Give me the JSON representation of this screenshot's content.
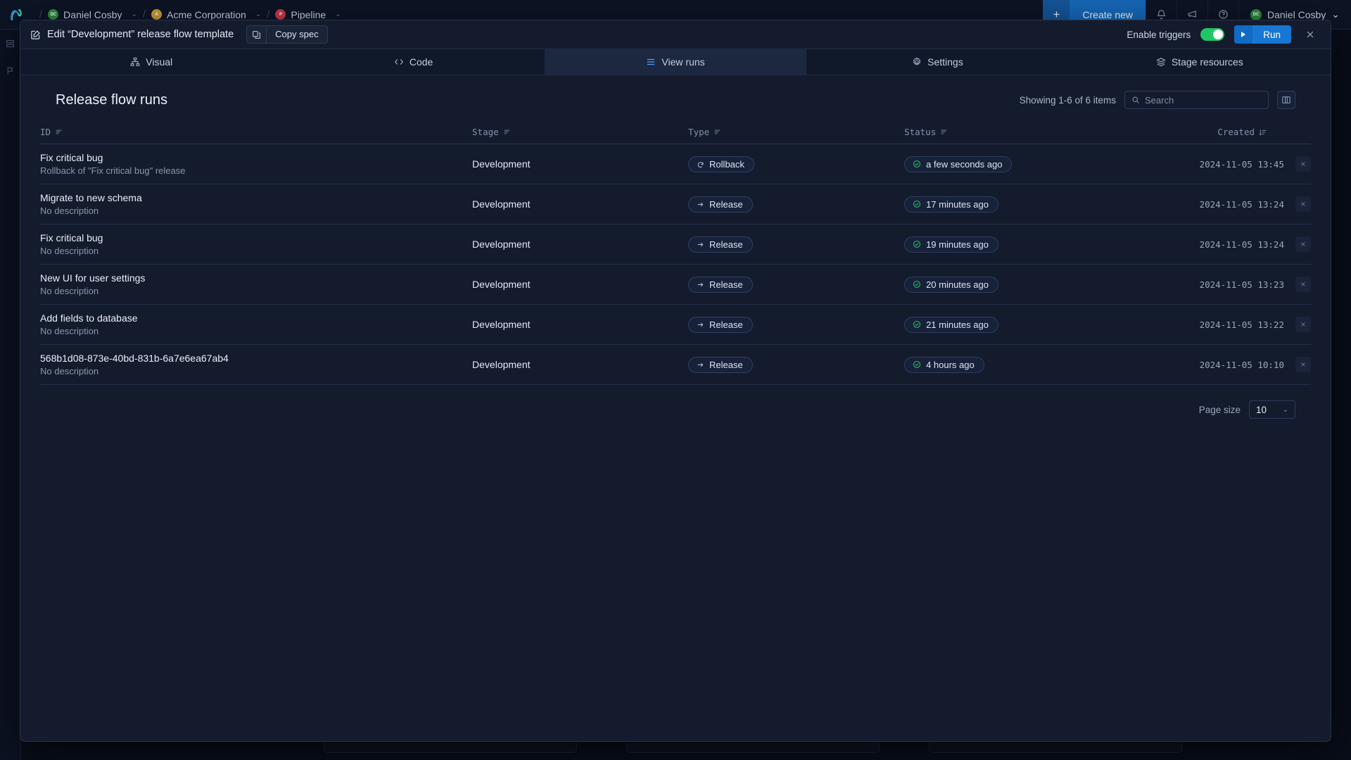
{
  "background": {
    "breadcrumbs": [
      {
        "label": "Daniel Cosby",
        "avatar_initials": "DC",
        "avatar_color": "#2d8a3e",
        "chevron": "⌄"
      },
      {
        "label": "Acme Corporation",
        "avatar_initials": "A",
        "avatar_color": "#c99a3a",
        "chevron": "⌄"
      },
      {
        "label": "Pipeline",
        "avatar_initials": "P",
        "avatar_color": "#c2384a",
        "chevron": "⌄"
      }
    ],
    "create_new_label": "Create new",
    "plus_glyph": "+",
    "top_icons": [
      "bell-icon",
      "megaphone-icon",
      "help-icon"
    ],
    "user": {
      "name": "Daniel Cosby",
      "initials": "DC",
      "chevron": "⌄"
    }
  },
  "modal": {
    "header": {
      "edit_icon": "pencil-square-icon",
      "title": "Edit “Development” release flow template",
      "copy_spec": {
        "icon": "copy-icon",
        "label": "Copy spec"
      },
      "enable_triggers_label": "Enable triggers",
      "enable_triggers_on": true,
      "toggle_color": "#20c566",
      "run": {
        "icon": "play-icon",
        "label": "Run",
        "color": "#1877d2"
      },
      "close": "close-icon"
    },
    "tabs": [
      {
        "label": "Visual",
        "icon": "sitemap-icon",
        "active": false
      },
      {
        "label": "Code",
        "icon": "code-icon",
        "active": false
      },
      {
        "label": "View runs",
        "icon": "list-icon",
        "active": true
      },
      {
        "label": "Settings",
        "icon": "gear-icon",
        "active": false
      },
      {
        "label": "Stage resources",
        "icon": "layers-icon",
        "active": false
      }
    ],
    "body": {
      "page_title": "Release flow runs",
      "showing_text": "Showing 1-6 of 6 items",
      "search": {
        "placeholder": "Search",
        "value": "",
        "icon": "search-icon"
      },
      "column_toggle_icon": "columns-icon",
      "table": {
        "columns": [
          {
            "label": "ID",
            "sort_icon": "sort-icon"
          },
          {
            "label": "Stage",
            "sort_icon": "sort-icon"
          },
          {
            "label": "Type",
            "sort_icon": "sort-icon"
          },
          {
            "label": "Status",
            "sort_icon": "sort-icon"
          },
          {
            "label": "Created",
            "sort_icon": "sort-desc-icon"
          }
        ],
        "rows": [
          {
            "id": "Fix critical bug",
            "description": "Rollback of \"Fix critical bug\" release",
            "stage": "Development",
            "type": "Rollback",
            "type_icon": "rollback-arrow-icon",
            "status": "a few seconds ago",
            "status_icon": "check-circle-icon",
            "created": "2024-11-05 13:45",
            "remove": "×"
          },
          {
            "id": "Migrate to new schema",
            "description": "No description",
            "stage": "Development",
            "type": "Release",
            "type_icon": "arrow-right-icon",
            "status": "17 minutes ago",
            "status_icon": "check-circle-icon",
            "created": "2024-11-05 13:24",
            "remove": "×"
          },
          {
            "id": "Fix critical bug",
            "description": "No description",
            "stage": "Development",
            "type": "Release",
            "type_icon": "arrow-right-icon",
            "status": "19 minutes ago",
            "status_icon": "check-circle-icon",
            "created": "2024-11-05 13:24",
            "remove": "×"
          },
          {
            "id": "New UI for user settings",
            "description": "No description",
            "stage": "Development",
            "type": "Release",
            "type_icon": "arrow-right-icon",
            "status": "20 minutes ago",
            "status_icon": "check-circle-icon",
            "created": "2024-11-05 13:23",
            "remove": "×"
          },
          {
            "id": "Add fields to database",
            "description": "No description",
            "stage": "Development",
            "type": "Release",
            "type_icon": "arrow-right-icon",
            "status": "21 minutes ago",
            "status_icon": "check-circle-icon",
            "created": "2024-11-05 13:22",
            "remove": "×"
          },
          {
            "id": "568b1d08-873e-40bd-831b-6a7e6ea67ab4",
            "description": "No description",
            "stage": "Development",
            "type": "Release",
            "type_icon": "arrow-right-icon",
            "status": "4 hours ago",
            "status_icon": "check-circle-icon",
            "created": "2024-11-05 10:10",
            "remove": "×"
          }
        ]
      },
      "footer": {
        "page_size_label": "Page size",
        "page_size_value": "10",
        "chevron": "⌄"
      }
    }
  }
}
